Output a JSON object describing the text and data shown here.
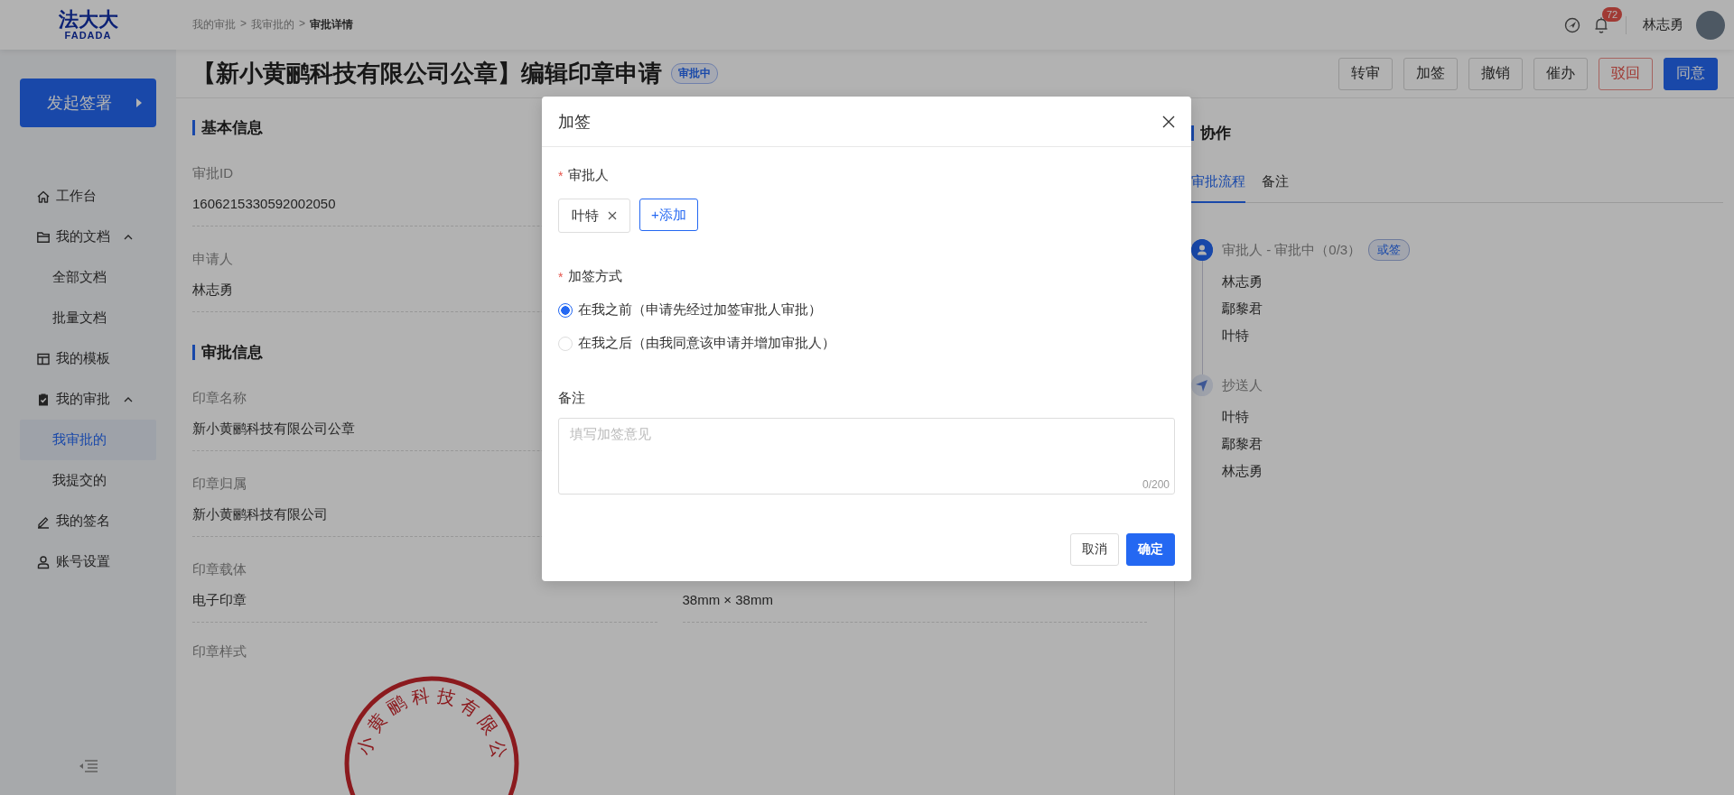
{
  "header": {
    "logo": {
      "mark": "法大大",
      "wordmark": "FADADA"
    },
    "breadcrumb": [
      {
        "label": "我的审批",
        "current": false
      },
      {
        "label": ">",
        "current": false
      },
      {
        "label": "我审批的",
        "current": false
      },
      {
        "label": ">",
        "current": false
      },
      {
        "label": "审批详情",
        "current": true
      }
    ],
    "notification_count": "72",
    "user_name": "林志勇"
  },
  "sidebar": {
    "start_button": "发起签署",
    "items": [
      {
        "label": "工作台",
        "selected": false
      },
      {
        "label": "我的文档",
        "selected": false,
        "expanded": true,
        "children": [
          {
            "label": "全部文档",
            "selected": false
          },
          {
            "label": "批量文档",
            "selected": false
          }
        ]
      },
      {
        "label": "我的模板",
        "selected": false
      },
      {
        "label": "我的审批",
        "selected": false,
        "expanded": true,
        "children": [
          {
            "label": "我审批的",
            "selected": true
          },
          {
            "label": "我提交的",
            "selected": false
          }
        ]
      },
      {
        "label": "我的签名",
        "selected": false
      },
      {
        "label": "账号设置",
        "selected": false
      }
    ]
  },
  "page": {
    "title": "【新小黄鹂科技有限公司公章】编辑印章申请",
    "status_badge": "审批中",
    "actions": [
      {
        "label": "转审",
        "kind": "default"
      },
      {
        "label": "加签",
        "kind": "default"
      },
      {
        "label": "撤销",
        "kind": "default"
      },
      {
        "label": "催办",
        "kind": "default"
      },
      {
        "label": "驳回",
        "kind": "danger"
      },
      {
        "label": "同意",
        "kind": "primary"
      }
    ]
  },
  "details": {
    "sections": [
      {
        "title": "基本信息",
        "rows": [
          {
            "left": {
              "label": "审批ID",
              "value": "1606215330592002050"
            }
          },
          {
            "left": {
              "label": "申请人",
              "value": "林志勇"
            }
          }
        ]
      },
      {
        "title": "审批信息",
        "rows": [
          {
            "left": {
              "label": "印章名称",
              "value": "新小黄鹂科技有限公司公章"
            }
          },
          {
            "left": {
              "label": "印章归属",
              "value": "新小黄鹂科技有限公司"
            }
          },
          {
            "left": {
              "label": "印章载体",
              "value": "电子印章"
            },
            "right": {
              "value": "38mm × 38mm"
            }
          }
        ]
      }
    ],
    "seal": {
      "label": "印章样式",
      "text": "小黄鹂科技有限公"
    }
  },
  "collaboration": {
    "title": "协作",
    "tabs": [
      {
        "label": "审批流程",
        "selected": true
      },
      {
        "label": "备注",
        "selected": false
      }
    ],
    "timeline": [
      {
        "kind": "approver",
        "title": "审批人 - 审批中（0/3）",
        "tag": "或签",
        "people": [
          "林志勇",
          "鄢黎君",
          "叶特"
        ]
      },
      {
        "kind": "cc",
        "title": "抄送人",
        "people": [
          "叶特",
          "鄢黎君",
          "林志勇"
        ]
      }
    ]
  },
  "dialog": {
    "title": "加签",
    "approvers": {
      "required_mark": "*",
      "label": "审批人",
      "chips": [
        "叶特"
      ],
      "add_button": "+添加"
    },
    "method": {
      "required_mark": "*",
      "label": "加签方式",
      "options": [
        {
          "label": "在我之前（申请先经过加签审批人审批）",
          "selected": true
        },
        {
          "label": "在我之后（由我同意该申请并增加审批人）",
          "selected": false
        }
      ]
    },
    "note": {
      "label": "备注",
      "placeholder": "填写加签意见",
      "counter": "0/200"
    },
    "buttons": [
      {
        "label": "取消",
        "kind": "default"
      },
      {
        "label": "确定",
        "kind": "primary"
      }
    ]
  }
}
